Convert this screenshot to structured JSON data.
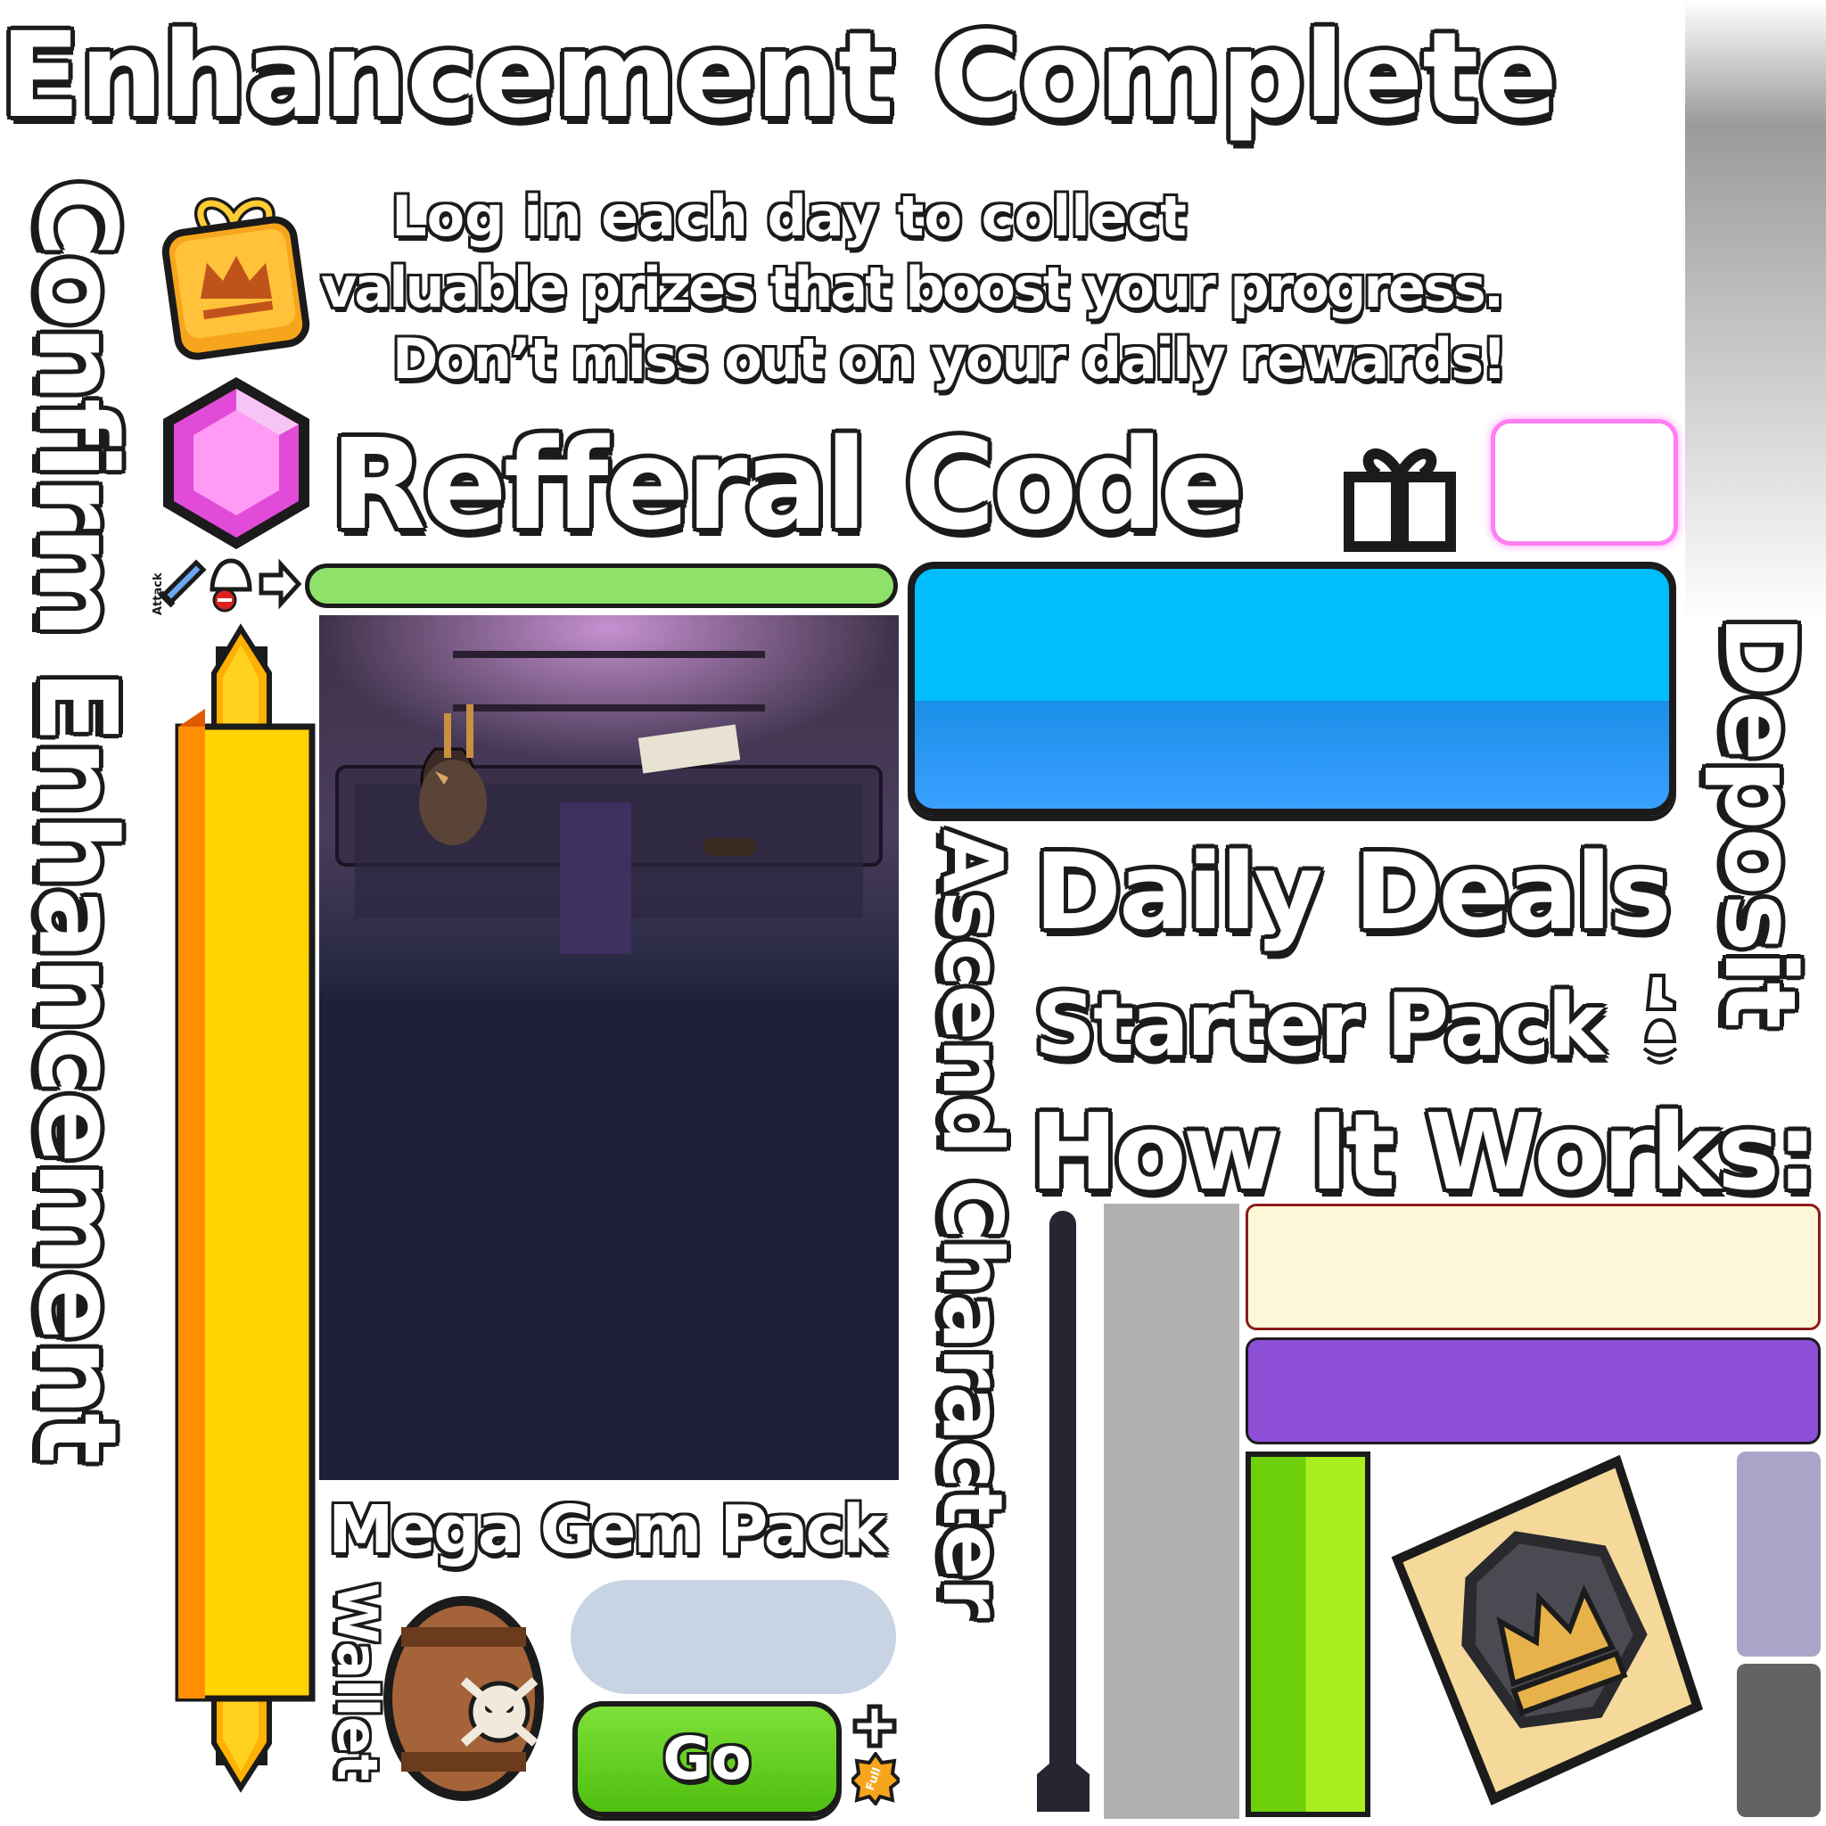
{
  "title": "Enhancement Complete",
  "login_text": {
    "line1": "Log in each day to collect",
    "line2": "valuable prizes that boost your progress.",
    "line3": "Don’t miss out on your daily rewards!"
  },
  "referral_label": "Refferal Code",
  "confirm_label": "Confirm Enhancement",
  "ascend_label": "Ascend Character",
  "deposit_label": "Deposit",
  "daily_deals_label": "Daily Deals",
  "starter_pack_label": "Starter Pack",
  "how_it_works_label": "How It Works:",
  "mega_gem_pack_label": "Mega Gem Pack",
  "wallet_label": "Wallet",
  "go_label": "Go",
  "attack_label": "Attack",
  "full_label": "Full",
  "colors": {
    "green_bar": "#8ee26a",
    "blue_button": "#00b2f5",
    "yellow_bar": "#ffd400",
    "cream_panel": "#fdf7d8",
    "purple_panel": "#8d4fd6",
    "go_button": "#5fcf1a",
    "pink_frame": "#ff7ff5",
    "dark_scene": "#1e2038"
  }
}
